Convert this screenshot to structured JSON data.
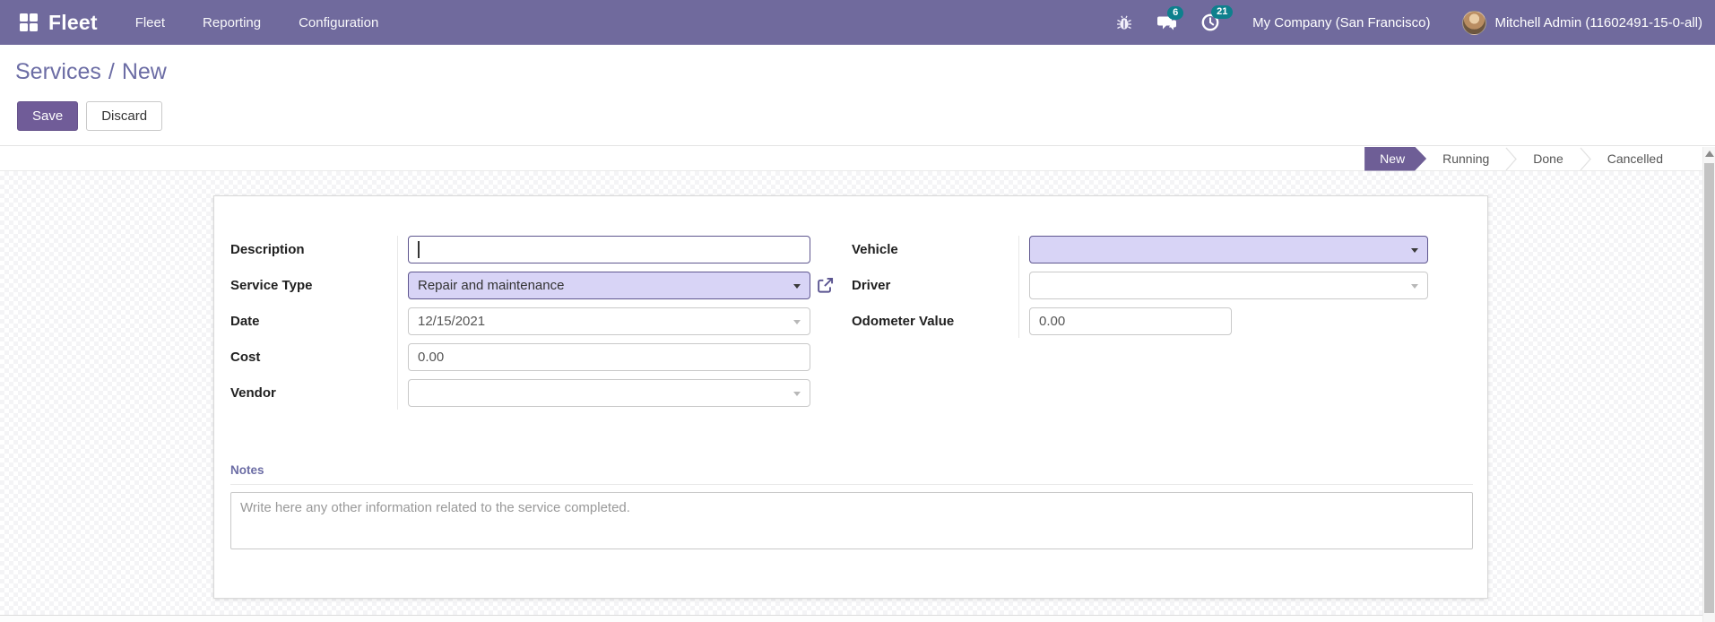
{
  "navbar": {
    "brand": "Fleet",
    "menus": [
      {
        "label": "Fleet"
      },
      {
        "label": "Reporting"
      },
      {
        "label": "Configuration"
      }
    ],
    "systray": {
      "messages_count": "6",
      "activities_count": "21",
      "company": "My Company (San Francisco)",
      "user": "Mitchell Admin (11602491-15-0-all)"
    },
    "icons": {
      "apps": "grid",
      "debug": "bug",
      "messages": "chat-bubbles",
      "activities": "clock"
    }
  },
  "control_panel": {
    "breadcrumb": {
      "parent": "Services",
      "separator": "/",
      "current": "New"
    },
    "buttons": {
      "save": "Save",
      "discard": "Discard"
    }
  },
  "statusbar": {
    "active": "New",
    "stages": [
      "New",
      "Running",
      "Done",
      "Cancelled"
    ]
  },
  "form": {
    "left": [
      {
        "label": "Description",
        "type": "text-focused",
        "value": ""
      },
      {
        "label": "Service Type",
        "type": "many2one",
        "value": "Repair and maintenance"
      },
      {
        "label": "Date",
        "type": "date",
        "value": "12/15/2021"
      },
      {
        "label": "Cost",
        "type": "number",
        "value": "0.00"
      },
      {
        "label": "Vendor",
        "type": "many2one",
        "value": ""
      }
    ],
    "right": [
      {
        "label": "Vehicle",
        "type": "many2one",
        "value": ""
      },
      {
        "label": "Driver",
        "type": "many2one",
        "value": ""
      },
      {
        "label": "Odometer Value",
        "type": "number",
        "value": "0.00"
      }
    ],
    "notes": {
      "label": "Notes",
      "placeholder": "Write here any other information related to the service completed."
    }
  },
  "colors": {
    "navbar_bg": "#706A9D",
    "primary_button": "#705C98",
    "stage_active_bg": "#6E5E96",
    "badge": "#0E808D",
    "field_highlight_bg": "#D8D4F6",
    "field_highlight_border": "#5F578F",
    "breadcrumb": "#6C6DA5"
  }
}
